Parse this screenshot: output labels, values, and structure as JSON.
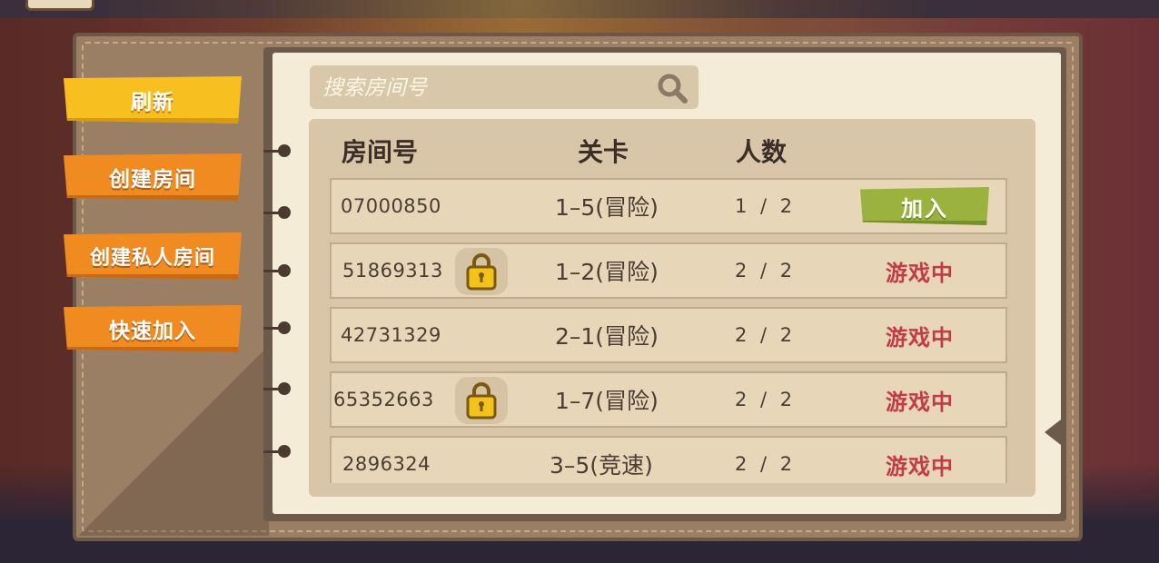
{
  "sidebar": {
    "refresh": "刷新",
    "create_room": "创建房间",
    "create_private_room": "创建私人房间",
    "quick_join": "快速加入"
  },
  "search": {
    "placeholder": "搜索房间号"
  },
  "columns": {
    "room_id": "房间号",
    "stage": "关卡",
    "players": "人数"
  },
  "rooms": [
    {
      "id": "07000850",
      "locked": false,
      "stage": "1–5(冒险)",
      "players": "1 / 2",
      "action": "加入"
    },
    {
      "id": "51869313",
      "locked": true,
      "stage": "1–2(冒险)",
      "players": "2 / 2",
      "status": "游戏中"
    },
    {
      "id": "42731329",
      "locked": false,
      "stage": "2–1(冒险)",
      "players": "2 / 2",
      "status": "游戏中"
    },
    {
      "id": "65352663",
      "locked": true,
      "stage": "1–7(冒险)",
      "players": "2 / 2",
      "status": "游戏中"
    },
    {
      "id": "2896324",
      "locked": false,
      "stage": "3–5(竞速)",
      "players": "2 / 2",
      "status": "游戏中"
    }
  ],
  "colors": {
    "accent_orange": "#f08b22",
    "accent_yellow": "#f7bf1f",
    "join_green": "#9bb23e",
    "status_red": "#c23b45"
  },
  "icons": {
    "search": "search-icon",
    "lock": "lock-icon"
  }
}
